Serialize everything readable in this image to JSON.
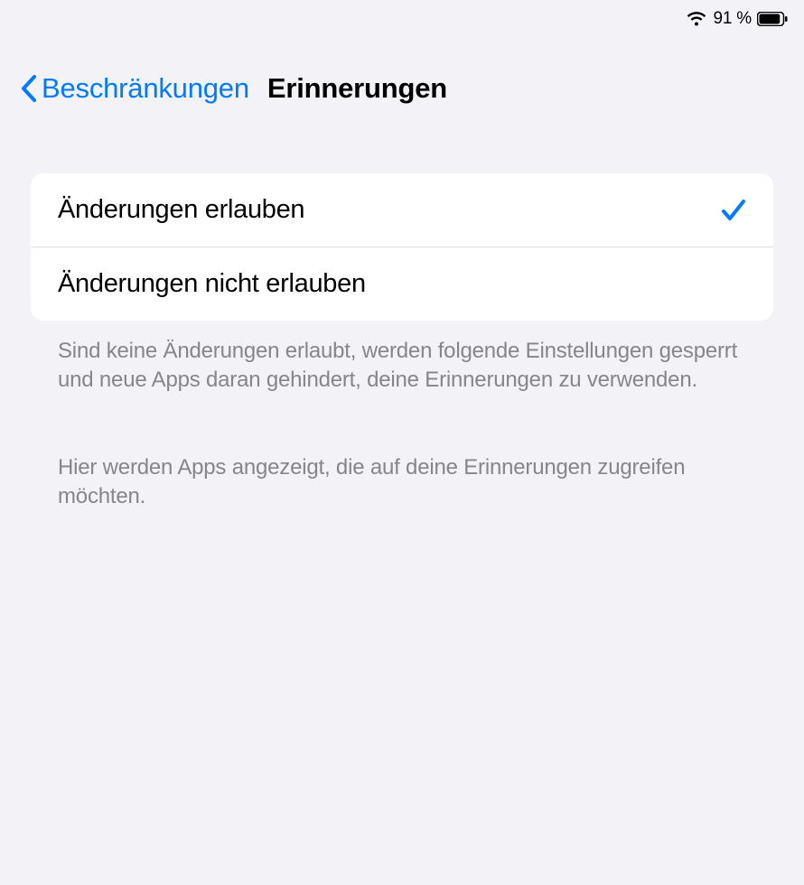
{
  "statusBar": {
    "batteryText": "91 %"
  },
  "nav": {
    "backLabel": "Beschränkungen",
    "title": "Erinnerungen"
  },
  "options": {
    "allow": "Änderungen erlauben",
    "disallow": "Änderungen nicht erlauben",
    "selectedIndex": 0
  },
  "footer": {
    "text1": "Sind keine Änderungen erlaubt, werden folgende Einstellungen gesperrt und neue Apps daran gehindert, deine Erinnerungen zu verwenden.",
    "text2": "Hier werden Apps angezeigt, die auf deine Erinnerungen zugreifen möchten."
  }
}
